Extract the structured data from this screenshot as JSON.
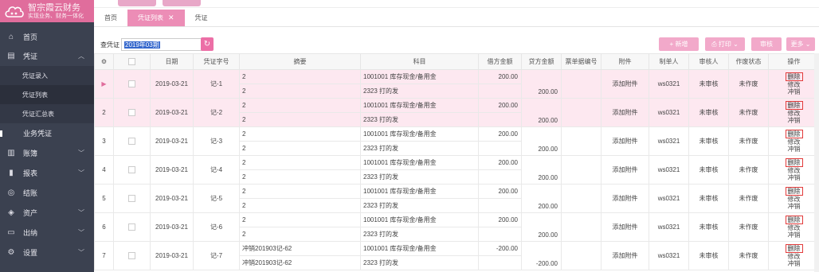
{
  "app": {
    "title": "智宗霞云财务",
    "subtitle": "实现业务、财务一体化"
  },
  "sidebar": {
    "items": [
      {
        "label": "首页",
        "icon": "home-icon",
        "glyph": "⌂",
        "chevron": false
      },
      {
        "label": "凭证",
        "icon": "document-icon",
        "glyph": "▤",
        "chevron": "up"
      },
      {
        "label": "业务凭证",
        "icon": "dot-icon",
        "glyph": "",
        "chevron": false
      },
      {
        "label": "账簿",
        "icon": "book-icon",
        "glyph": "▥",
        "chevron": "down"
      },
      {
        "label": "报表",
        "icon": "chart-icon",
        "glyph": "▮",
        "chevron": "down"
      },
      {
        "label": "结账",
        "icon": "settle-icon",
        "glyph": "◎",
        "chevron": false
      },
      {
        "label": "资产",
        "icon": "asset-icon",
        "glyph": "◈",
        "chevron": "down"
      },
      {
        "label": "出纳",
        "icon": "cashier-icon",
        "glyph": "▭",
        "chevron": "down"
      },
      {
        "label": "设置",
        "icon": "gear-icon",
        "glyph": "⚙",
        "chevron": "down"
      }
    ],
    "sub_items": [
      {
        "label": "凭证录入"
      },
      {
        "label": "凭证列表"
      },
      {
        "label": "凭证汇总表"
      }
    ]
  },
  "tabs": [
    {
      "label": "首页",
      "active": false
    },
    {
      "label": "凭证列表",
      "active": true,
      "closable": true
    },
    {
      "label": "凭证",
      "active": false
    }
  ],
  "toolbar": {
    "query_label": "查凭证",
    "period": "2019年03期",
    "add_label": "+ 新增",
    "print_label": "打印",
    "audit_label": "审核",
    "more_label": "更多"
  },
  "table": {
    "headers": [
      "",
      "",
      "日期",
      "凭证字号",
      "摘要",
      "科目",
      "借方金额",
      "贷方金额",
      "票单据编号",
      "附件",
      "制单人",
      "审核人",
      "作废状态",
      "操作"
    ],
    "rows": [
      {
        "idx": "▶",
        "date": "2019-03-21",
        "no": "记-1",
        "lines": [
          {
            "summary": "2",
            "subject": "1001001 库存现金/备用金",
            "debit": "200.00",
            "credit": ""
          },
          {
            "summary": "2",
            "subject": "2323 打的发",
            "debit": "",
            "credit": "200.00"
          }
        ],
        "attach": "添加附件",
        "maker": "ws0321",
        "auditor": "未审核",
        "status": "未作废",
        "highlight": true
      },
      {
        "idx": "2",
        "date": "2019-03-21",
        "no": "记-2",
        "lines": [
          {
            "summary": "2",
            "subject": "1001001 库存现金/备用金",
            "debit": "200.00",
            "credit": ""
          },
          {
            "summary": "2",
            "subject": "2323 打的发",
            "debit": "",
            "credit": "200.00"
          }
        ],
        "attach": "添加附件",
        "maker": "ws0321",
        "auditor": "未审核",
        "status": "未作废",
        "highlight": true
      },
      {
        "idx": "3",
        "date": "2019-03-21",
        "no": "记-3",
        "lines": [
          {
            "summary": "2",
            "subject": "1001001 库存现金/备用金",
            "debit": "200.00",
            "credit": ""
          },
          {
            "summary": "2",
            "subject": "2323 打的发",
            "debit": "",
            "credit": "200.00"
          }
        ],
        "attach": "添加附件",
        "maker": "ws0321",
        "auditor": "未审核",
        "status": "未作废",
        "highlight": false
      },
      {
        "idx": "4",
        "date": "2019-03-21",
        "no": "记-4",
        "lines": [
          {
            "summary": "2",
            "subject": "1001001 库存现金/备用金",
            "debit": "200.00",
            "credit": ""
          },
          {
            "summary": "2",
            "subject": "2323 打的发",
            "debit": "",
            "credit": "200.00"
          }
        ],
        "attach": "添加附件",
        "maker": "ws0321",
        "auditor": "未审核",
        "status": "未作废",
        "highlight": false
      },
      {
        "idx": "5",
        "date": "2019-03-21",
        "no": "记-5",
        "lines": [
          {
            "summary": "2",
            "subject": "1001001 库存现金/备用金",
            "debit": "200.00",
            "credit": ""
          },
          {
            "summary": "2",
            "subject": "2323 打的发",
            "debit": "",
            "credit": "200.00"
          }
        ],
        "attach": "添加附件",
        "maker": "ws0321",
        "auditor": "未审核",
        "status": "未作废",
        "highlight": false
      },
      {
        "idx": "6",
        "date": "2019-03-21",
        "no": "记-6",
        "lines": [
          {
            "summary": "2",
            "subject": "1001001 库存现金/备用金",
            "debit": "200.00",
            "credit": ""
          },
          {
            "summary": "2",
            "subject": "2323 打的发",
            "debit": "",
            "credit": "200.00"
          }
        ],
        "attach": "添加附件",
        "maker": "ws0321",
        "auditor": "未审核",
        "status": "未作废",
        "highlight": false
      },
      {
        "idx": "7",
        "date": "2019-03-21",
        "no": "记-7",
        "lines": [
          {
            "summary": "冲销201903记-62",
            "subject": "1001001 库存现金/备用金",
            "debit": "-200.00",
            "credit": ""
          },
          {
            "summary": "冲销201903记-62",
            "subject": "2323 打的发",
            "debit": "",
            "credit": "-200.00"
          }
        ],
        "attach": "添加附件",
        "maker": "ws0321",
        "auditor": "未审核",
        "status": "未作废",
        "highlight": false
      }
    ],
    "ops": {
      "delete": "删除",
      "edit": "修改",
      "reverse": "冲销"
    }
  }
}
